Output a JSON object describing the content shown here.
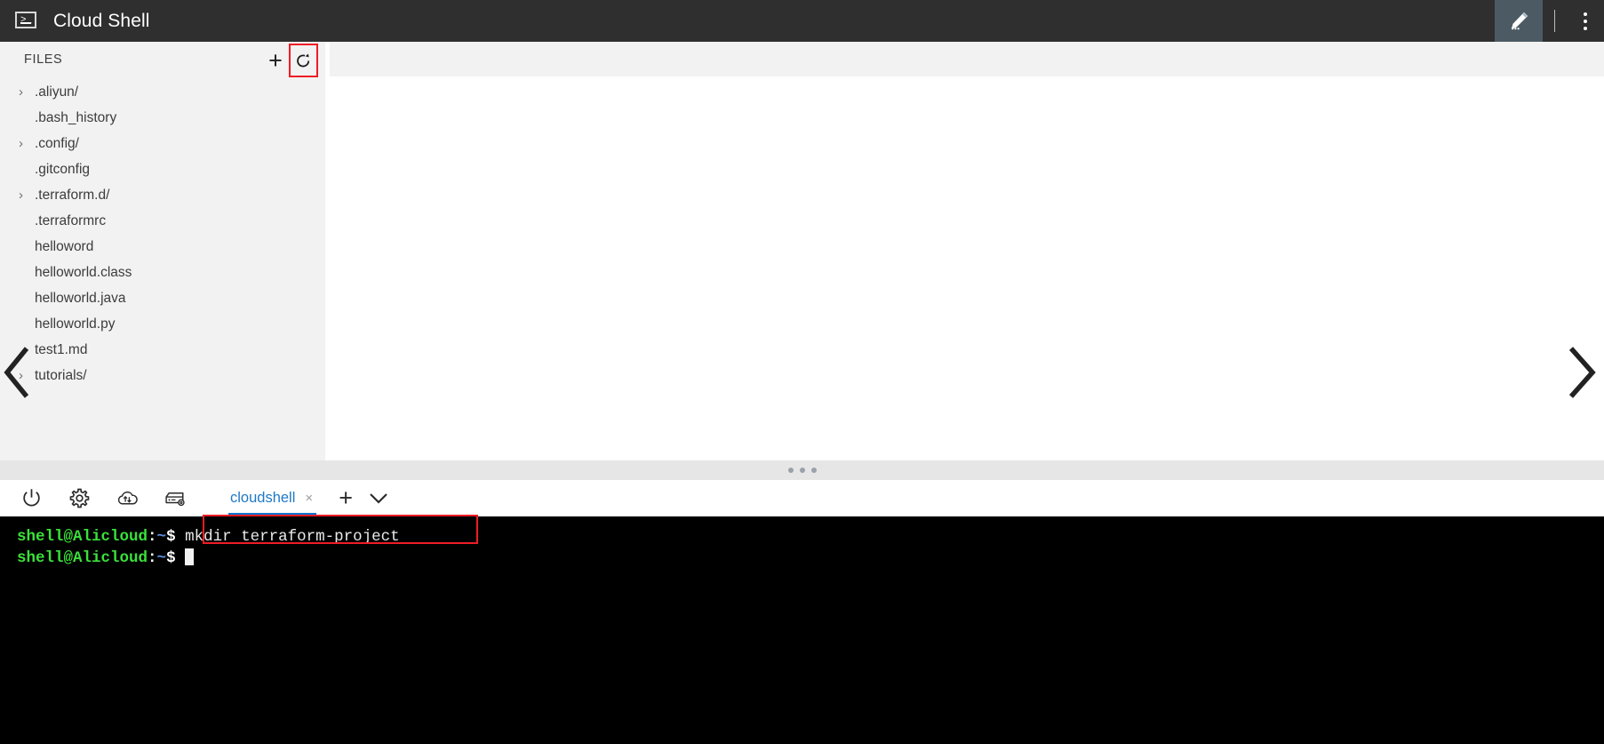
{
  "titlebar": {
    "app_icon": "terminal-console-icon",
    "title": "Cloud Shell",
    "prompt_glyph": ">_",
    "edit_icon": "pencil-edit-icon",
    "menu_icon": "kebab-menu-icon"
  },
  "sidebar": {
    "header_label": "FILES",
    "add_icon": "plus-icon",
    "add_label": "+",
    "refresh_icon": "refresh-icon",
    "files": [
      {
        "name": ".aliyun/",
        "expandable": true,
        "chevron": "›"
      },
      {
        "name": ".bash_history",
        "expandable": false,
        "chevron": "›"
      },
      {
        "name": ".config/",
        "expandable": true,
        "chevron": "›"
      },
      {
        "name": ".gitconfig",
        "expandable": false,
        "chevron": "›"
      },
      {
        "name": ".terraform.d/",
        "expandable": true,
        "chevron": "›"
      },
      {
        "name": ".terraformrc",
        "expandable": false,
        "chevron": "›"
      },
      {
        "name": "helloword",
        "expandable": false,
        "chevron": "›"
      },
      {
        "name": "helloworld.class",
        "expandable": false,
        "chevron": "›"
      },
      {
        "name": "helloworld.java",
        "expandable": false,
        "chevron": "›"
      },
      {
        "name": "helloworld.py",
        "expandable": false,
        "chevron": "›"
      },
      {
        "name": "test1.md",
        "expandable": false,
        "chevron": "›"
      },
      {
        "name": "tutorials/",
        "expandable": true,
        "chevron": "›"
      }
    ]
  },
  "panels": {
    "collapse_left_icon": "chevron-left-icon",
    "collapse_right_icon": "chevron-right-icon",
    "splitter_icon": "drag-handle-dots-icon"
  },
  "shell_toolbar": {
    "icons": [
      {
        "name": "power-icon",
        "title": "Power"
      },
      {
        "name": "settings-gear-icon",
        "title": "Settings"
      },
      {
        "name": "cloud-transfer-icon",
        "title": "Upload/Download"
      },
      {
        "name": "storage-config-icon",
        "title": "Storage"
      }
    ],
    "tabs": [
      {
        "label": "cloudshell",
        "active": true,
        "close_label": "×"
      }
    ],
    "new_tab_label": "+",
    "new_tab_icon": "plus-icon",
    "tab_menu_icon": "chevron-down-icon"
  },
  "terminal": {
    "lines": [
      {
        "user": "shell@Alicloud",
        "colon": ":",
        "path": "~",
        "dollar": "$",
        "command": "mkdir terraform-project",
        "cursor": false
      },
      {
        "user": "shell@Alicloud",
        "colon": ":",
        "path": "~",
        "dollar": "$",
        "command": "",
        "cursor": true
      }
    ]
  },
  "annotations": {
    "refresh_box": "red-highlight-box",
    "command_box": "red-highlight-box"
  },
  "colors": {
    "titlebar_bg": "#2f2f2f",
    "sidebar_bg": "#f2f2f2",
    "editor_bg": "#ffffff",
    "terminal_bg": "#000000",
    "accent_blue": "#0f75cb",
    "tab_text": "#2079c7",
    "annotation_red": "#ee1c25",
    "prompt_green": "#3ae03a",
    "edit_btn_bg": "#4c5b63"
  }
}
